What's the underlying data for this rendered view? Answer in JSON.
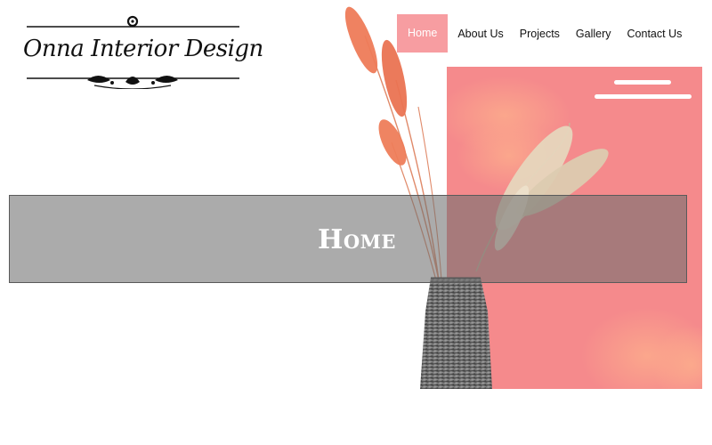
{
  "logo": {
    "text": "Onna Interior Design"
  },
  "nav": {
    "items": [
      {
        "label": "Home",
        "active": true
      },
      {
        "label": "About Us",
        "active": false
      },
      {
        "label": "Projects",
        "active": false
      },
      {
        "label": "Gallery",
        "active": false
      },
      {
        "label": "Contact Us",
        "active": false
      }
    ]
  },
  "hero": {
    "title": "Home",
    "menu_icon": "hamburger-icon"
  },
  "colors": {
    "accent": "#f79da1",
    "panel": "#f58a8c",
    "banner": "#6e6e6e"
  }
}
